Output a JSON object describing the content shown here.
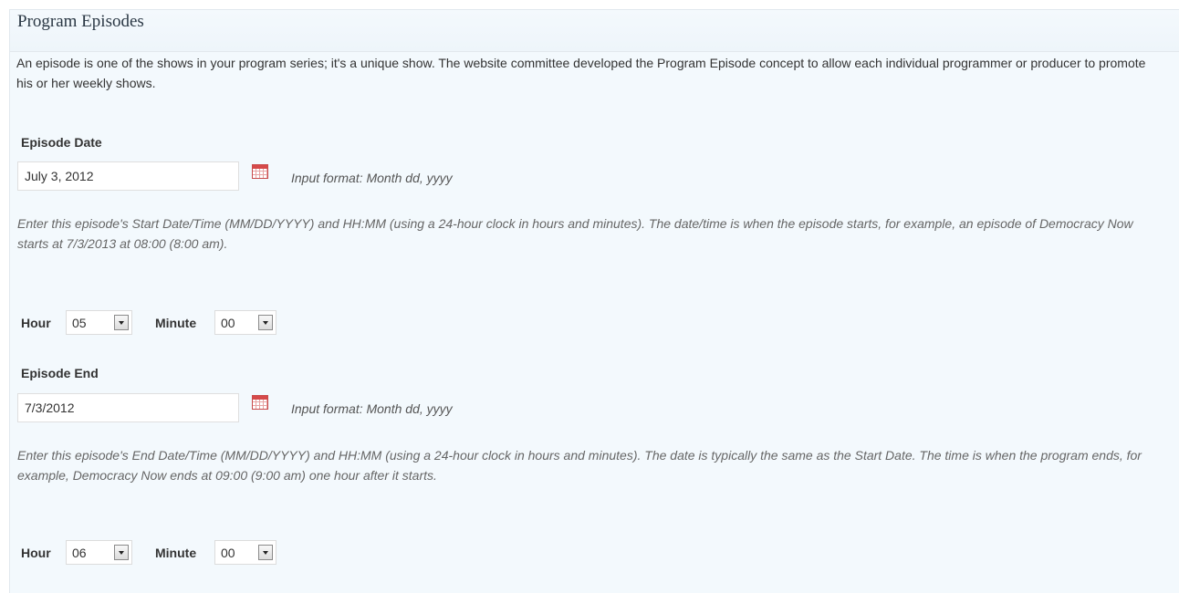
{
  "section": {
    "title": "Program Episodes",
    "intro": "An episode is one of the shows in your program series; it's a unique show. The website committee developed the Program Episode concept to allow each individual programmer or producer to promote his or her weekly shows."
  },
  "episode_date": {
    "label": "Episode Date",
    "value": "July 3, 2012",
    "format_hint": "Input format: Month dd, yyyy",
    "description": "Enter this episode's Start Date/Time (MM/DD/YYYY) and HH:MM (using a 24-hour clock in hours and minutes). The date/time is when the episode starts, for example, an episode of Democracy Now starts at 7/3/2013 at 08:00 (8:00 am).",
    "hour_label": "Hour",
    "hour_value": "05",
    "minute_label": "Minute",
    "minute_value": "00"
  },
  "episode_end": {
    "label": "Episode End",
    "value": "7/3/2012",
    "format_hint": "Input format: Month dd, yyyy",
    "description": "Enter this episode's End Date/Time (MM/DD/YYYY) and HH:MM (using a 24-hour clock in hours and minutes). The date is typically the same as the Start Date. The time is when the program ends, for example, Democracy Now ends at 09:00 (9:00 am) one hour after it starts.",
    "hour_label": "Hour",
    "hour_value": "06",
    "minute_label": "Minute",
    "minute_value": "00"
  },
  "icons": {
    "calendar": "calendar-icon",
    "dropdown": "chevron-down-icon"
  },
  "colors": {
    "panel_background": "#f3f9fd",
    "calendar_red": "#d64a4a"
  }
}
